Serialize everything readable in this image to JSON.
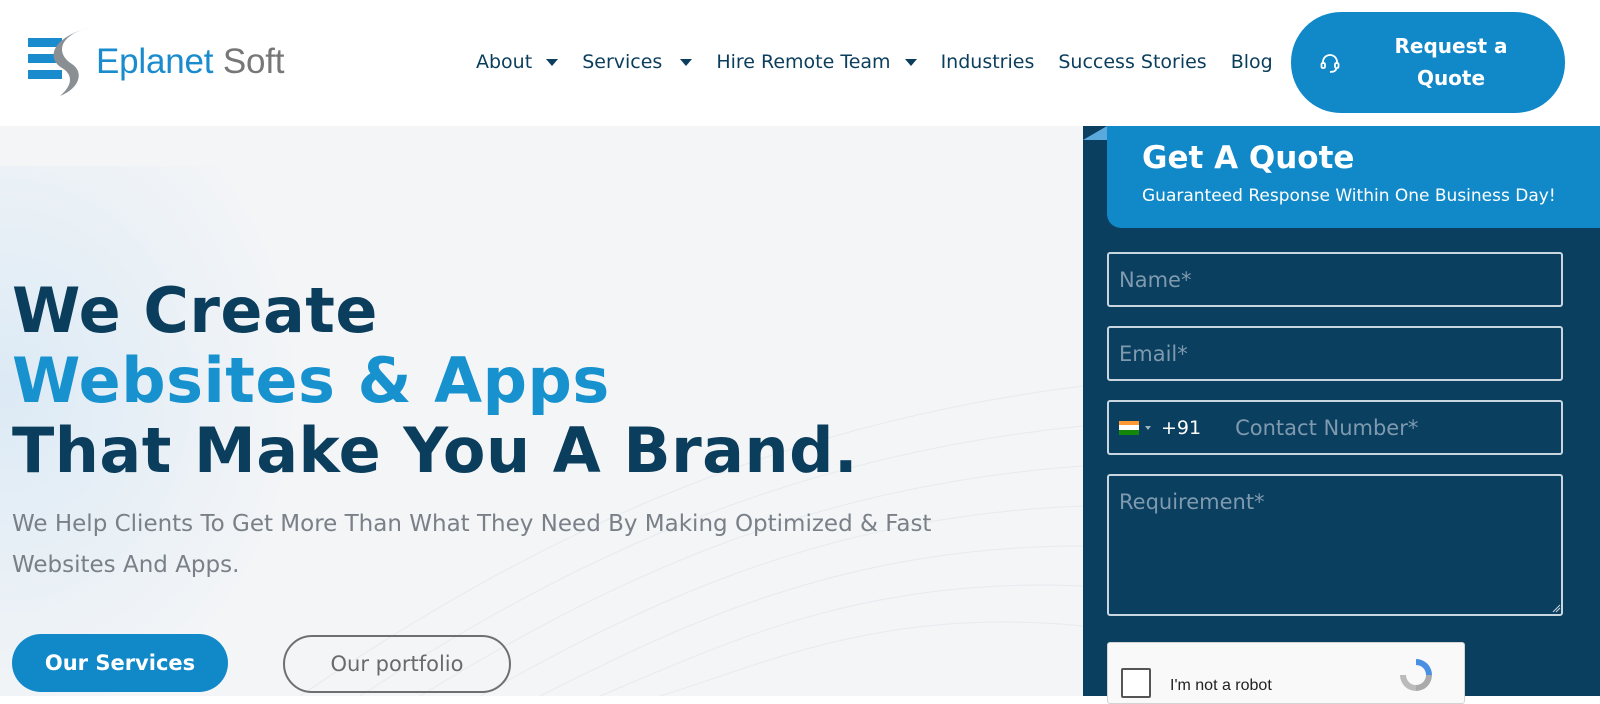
{
  "brand": {
    "name_part1": "Eplanet",
    "name_part2": "Soft",
    "colors": {
      "primary": "#1189c9",
      "navy": "#0b3d5c",
      "panel": "#0a3f60"
    }
  },
  "nav": {
    "items": [
      {
        "label": "About",
        "has_dropdown": true
      },
      {
        "label": "Services",
        "has_dropdown": true
      },
      {
        "label": "Hire Remote Team",
        "has_dropdown": true
      },
      {
        "label": "Industries",
        "has_dropdown": false
      },
      {
        "label": "Success Stories",
        "has_dropdown": false
      },
      {
        "label": "Blog",
        "has_dropdown": false
      }
    ],
    "cta": {
      "label": "Request a Quote",
      "icon": "headset-icon"
    }
  },
  "hero": {
    "line1": "We Create",
    "line2": "Websites & Apps",
    "line3": "That Make You A Brand.",
    "subtitle": "We Help Clients To Get More Than What They Need By Making Optimized & Fast Websites And Apps.",
    "btn_primary": "Our Services",
    "btn_secondary": "Our portfolio"
  },
  "quote_form": {
    "title": "Get A Quote",
    "subtitle": "Guaranteed Response Within One Business Day!",
    "name_placeholder": "Name*",
    "email_placeholder": "Email*",
    "country_flag": "india-flag-icon",
    "dial_code": "+91",
    "phone_placeholder": "Contact Number*",
    "requirement_placeholder": "Requirement*",
    "captcha_label": "I'm not a robot"
  }
}
